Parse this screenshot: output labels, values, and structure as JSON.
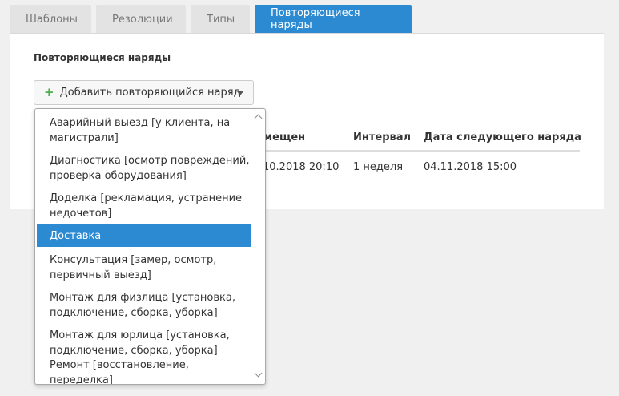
{
  "tabs": [
    {
      "label": "Шаблоны",
      "active": false
    },
    {
      "label": "Резолюции",
      "active": false
    },
    {
      "label": "Типы",
      "active": false
    },
    {
      "label": "Повторяющиеся наряды",
      "active": true
    }
  ],
  "panel": {
    "title": "Повторяющиеся наряды",
    "add_button_label": "Добавить повторяющийся наряд"
  },
  "table": {
    "columns": [
      "змещен",
      "Интервал",
      "Дата следующего наряда"
    ],
    "rows": [
      [
        "10.2018 20:10",
        "1 неделя",
        "04.11.2018 15:00"
      ]
    ]
  },
  "dropdown": {
    "options": [
      {
        "label": "Аварийный выезд [у клиента, на магистрали]",
        "selected": false
      },
      {
        "label": "Диагностика [осмотр повреждений, проверка оборудования]",
        "selected": false
      },
      {
        "label": "Доделка [рекламация, устранение недочетов]",
        "selected": false
      },
      {
        "label": "Доставка",
        "selected": true
      },
      {
        "label": "Консультация [замер, осмотр, первичный выезд]",
        "selected": false
      },
      {
        "label": "Монтаж для физлица [установка, подключение, сборка, уборка]",
        "selected": false
      },
      {
        "label": "Монтаж для юрлица [установка, подключение, сборка, уборка]",
        "selected": false
      },
      {
        "label": "Ремонт [восстановление, переделка]",
        "selected": false
      }
    ]
  },
  "colors": {
    "accent": "#2b8ad2",
    "plus_icon": "#4cae4c",
    "background": "#f0f0f0"
  },
  "icons": {
    "add_button": "plus-icon",
    "add_button_caret": "caret-down-icon",
    "scroll_up": "chevron-up-icon",
    "scroll_down": "chevron-down-icon"
  }
}
